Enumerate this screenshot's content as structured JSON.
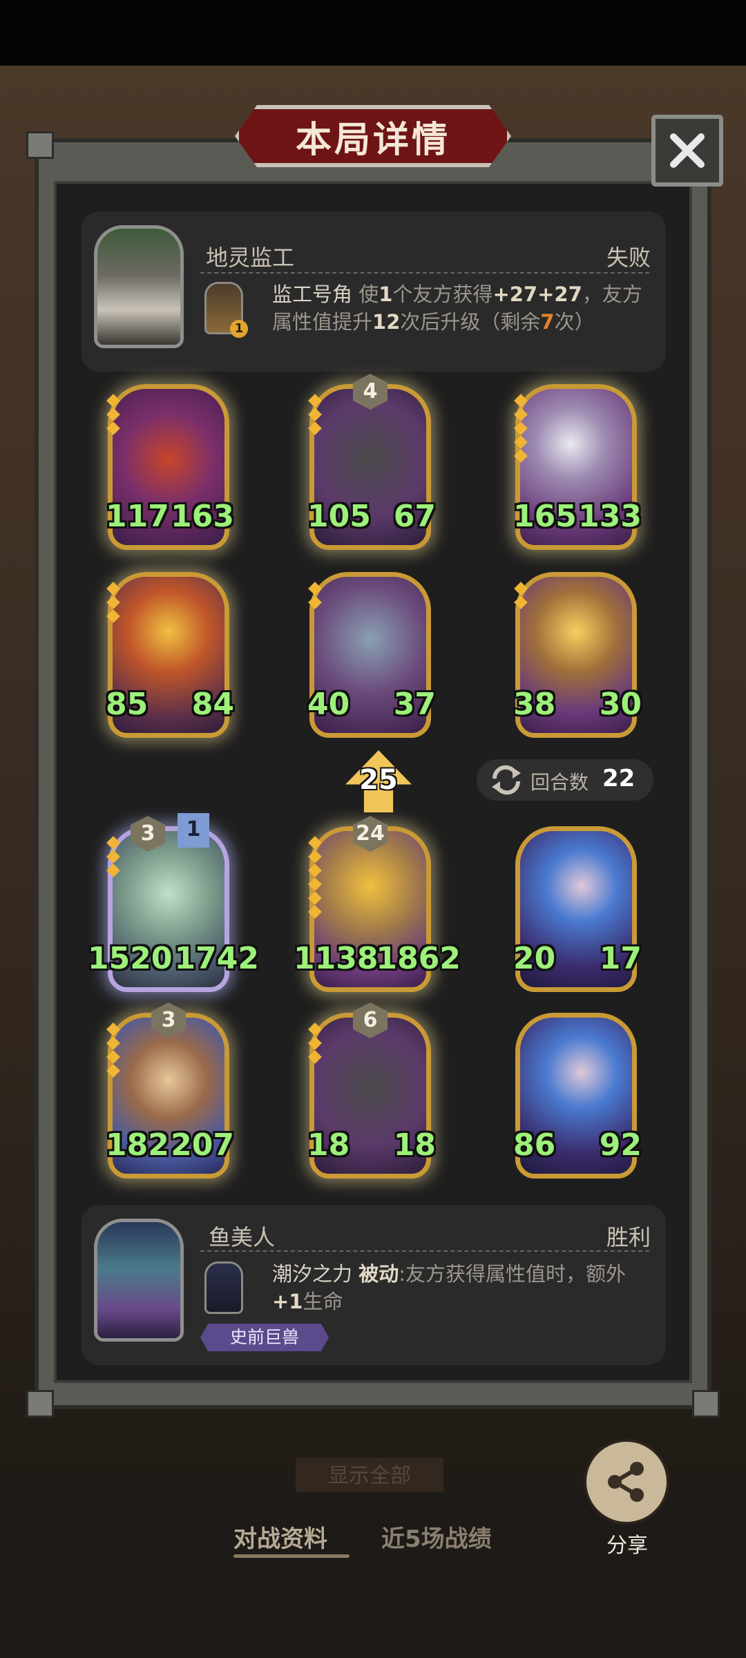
{
  "title": "本局详情",
  "opponent": {
    "name": "地灵监工",
    "result": "失败",
    "skill_name": "监工号角",
    "skill_prefix": " 使",
    "skill_n1": "1",
    "skill_mid1": "个友方获得",
    "skill_n2": "+27+27",
    "skill_mid2": "，友方属性值提升",
    "skill_n3": "12",
    "skill_mid3": "次后升级（剩余",
    "skill_n4": "7",
    "skill_end": "次）",
    "skill_badge": "1"
  },
  "opponent_cards": [
    {
      "atk": "117",
      "hp": "163",
      "badge": ""
    },
    {
      "atk": "105",
      "hp": "67",
      "badge": "4"
    },
    {
      "atk": "165",
      "hp": "133",
      "badge": ""
    },
    {
      "atk": "85",
      "hp": "84",
      "badge": ""
    },
    {
      "atk": "40",
      "hp": "37",
      "badge": ""
    },
    {
      "atk": "38",
      "hp": "30",
      "badge": ""
    }
  ],
  "turn": {
    "label": "回合数",
    "value": "22",
    "boost": "25"
  },
  "player_cards": [
    {
      "atk": "1520",
      "hp": "1742",
      "badge": "3",
      "tier": "1"
    },
    {
      "atk": "1138",
      "hp": "1862",
      "badge": "24"
    },
    {
      "atk": "20",
      "hp": "17",
      "badge": ""
    },
    {
      "atk": "182",
      "hp": "207",
      "badge": "3"
    },
    {
      "atk": "18",
      "hp": "18",
      "badge": "6"
    },
    {
      "atk": "86",
      "hp": "92",
      "badge": ""
    }
  ],
  "player": {
    "name": "鱼美人",
    "result": "胜利",
    "skill_name": "潮汐之力",
    "skill_type": "被动",
    "skill_desc": ":友方获得属性值时，额外",
    "skill_bonus": "+1",
    "skill_end": "生命",
    "tribe": "史前巨兽"
  },
  "bottom": {
    "show_all": "显示全部",
    "tab1": "对战资料",
    "tab2": "近5场战绩",
    "share": "分享"
  },
  "colors": {
    "stat_green": "#9df07a",
    "gold_frame": "#c99a36",
    "banner_red": "#6e1414"
  }
}
